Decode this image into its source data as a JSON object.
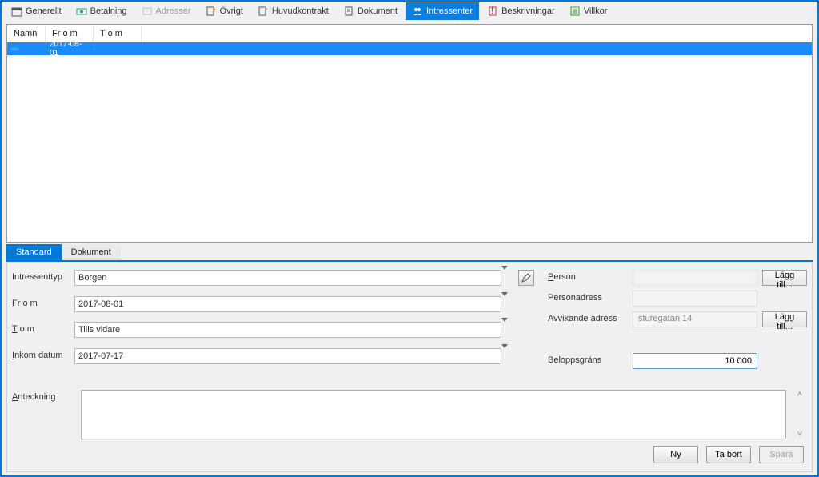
{
  "tabs": {
    "generellt": "Generellt",
    "betalning": "Betalning",
    "adresser": "Adresser",
    "ovrigt": "Övrigt",
    "huvudkontrakt": "Huvudkontrakt",
    "dokument": "Dokument",
    "intressenter": "Intressenter",
    "beskrivningar": "Beskrivningar",
    "villkor": "Villkor"
  },
  "grid": {
    "headers": {
      "namn": "Namn",
      "from": "Fr o m",
      "tom": "T o m"
    },
    "rows": [
      {
        "namn": "—",
        "from": "2017-08-01",
        "tom": ""
      }
    ]
  },
  "subtabs": {
    "standard": "Standard",
    "dokument": "Dokument"
  },
  "form": {
    "labels": {
      "intressenttyp": "Intressenttyp",
      "from_pre": "F",
      "from_rest": "r o m",
      "tom_pre": "T",
      "tom_rest": " o m",
      "inkom_pre": "I",
      "inkom_rest": "nkom datum",
      "person_pre": "P",
      "person_rest": "erson",
      "personadress": "Personadress",
      "avvikande": "Avvikande adress",
      "beloppsgrans": "Beloppsgräns",
      "anteckning_pre": "A",
      "anteckning_rest": "nteckning"
    },
    "values": {
      "intressenttyp": "Borgen",
      "from": "2017-08-01",
      "tom": "Tills vidare",
      "inkom": "2017-07-17",
      "person": "",
      "personadress": "",
      "avvikande": "sturegatan 14",
      "belopp": "10 000",
      "anteckning": ""
    },
    "buttons": {
      "lagg_till": "Lägg till...",
      "ny_pre": "N",
      "ny_rest": "y",
      "tabort_pre": "Ta bo",
      "tabort_u": "r",
      "tabort_post": "t",
      "spara": "Spara"
    }
  }
}
